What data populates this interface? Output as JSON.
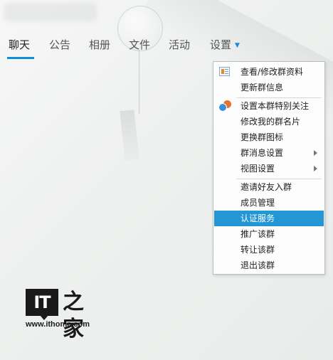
{
  "tabs": [
    {
      "label": "聊天",
      "active": true
    },
    {
      "label": "公告"
    },
    {
      "label": "相册"
    },
    {
      "label": "文件"
    },
    {
      "label": "活动"
    },
    {
      "label": "设置",
      "has_dropdown": true
    }
  ],
  "settings_menu": {
    "groups": [
      [
        {
          "label": "查看/修改群资料",
          "icon": "group-info-icon"
        },
        {
          "label": "更新群信息"
        }
      ],
      [
        {
          "label": "设置本群特别关注",
          "icon": "special-follow-icon"
        },
        {
          "label": "修改我的群名片"
        },
        {
          "label": "更换群图标"
        },
        {
          "label": "群消息设置",
          "submenu": true
        },
        {
          "label": "视图设置",
          "submenu": true
        }
      ],
      [
        {
          "label": "邀请好友入群"
        },
        {
          "label": "成员管理"
        },
        {
          "label": "认证服务",
          "highlighted": true
        },
        {
          "label": "推广该群"
        },
        {
          "label": "转让该群"
        },
        {
          "label": "退出该群"
        }
      ]
    ]
  },
  "watermark": {
    "logo_text": "IT之家",
    "url": "www.ithome.com"
  },
  "colors": {
    "accent": "#0c8ed9",
    "menu_highlight": "#2396d6"
  }
}
